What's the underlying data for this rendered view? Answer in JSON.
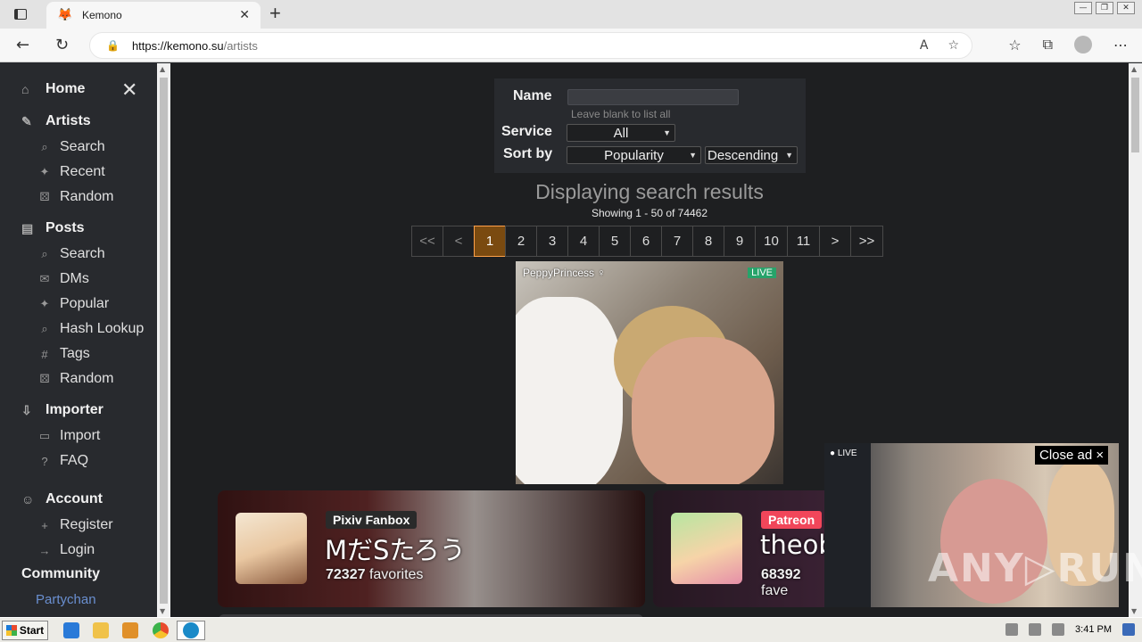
{
  "browser": {
    "tab_title": "Kemono",
    "new_tab": "+",
    "url_host": "https://kemono.su",
    "url_path": "/artists"
  },
  "sidebar": {
    "home": "Home",
    "artists": {
      "label": "Artists",
      "items": [
        "Search",
        "Recent",
        "Random"
      ]
    },
    "posts": {
      "label": "Posts",
      "items": [
        "Search",
        "DMs",
        "Popular",
        "Hash Lookup",
        "Tags",
        "Random"
      ]
    },
    "importer": {
      "label": "Importer",
      "items": [
        "Import",
        "FAQ"
      ]
    },
    "account": {
      "label": "Account",
      "items": [
        "Register",
        "Login"
      ]
    },
    "community": "Community",
    "partychan": "Partychan"
  },
  "search": {
    "name_label": "Name",
    "name_hint": "Leave blank to list all",
    "service_label": "Service",
    "service_value": "All",
    "sort_label": "Sort by",
    "sort_value": "Popularity",
    "order_value": "Descending"
  },
  "results": {
    "title": "Displaying search results",
    "count": "Showing 1 - 50 of 74462"
  },
  "pager": [
    "<<",
    "<",
    "1",
    "2",
    "3",
    "4",
    "5",
    "6",
    "7",
    "8",
    "9",
    "10",
    "11",
    ">",
    ">>"
  ],
  "ad": {
    "username": "PeppyPrincess ♀",
    "live": "LIVE"
  },
  "cards": [
    {
      "service": "Pixiv Fanbox",
      "service_color": "#2a2a2a",
      "name": "MだSたろう",
      "favorites": "72327",
      "fav_label": "favorites"
    },
    {
      "service": "Patreon",
      "service_color": "#f1465a",
      "name": "theob",
      "favorites": "68392",
      "fav_label": "fave"
    }
  ],
  "float_ad": {
    "live": "LIVE",
    "close": "Close ad ×",
    "watermark": "ANY▷RUN"
  },
  "taskbar": {
    "start": "Start",
    "time": "3:41 PM"
  }
}
